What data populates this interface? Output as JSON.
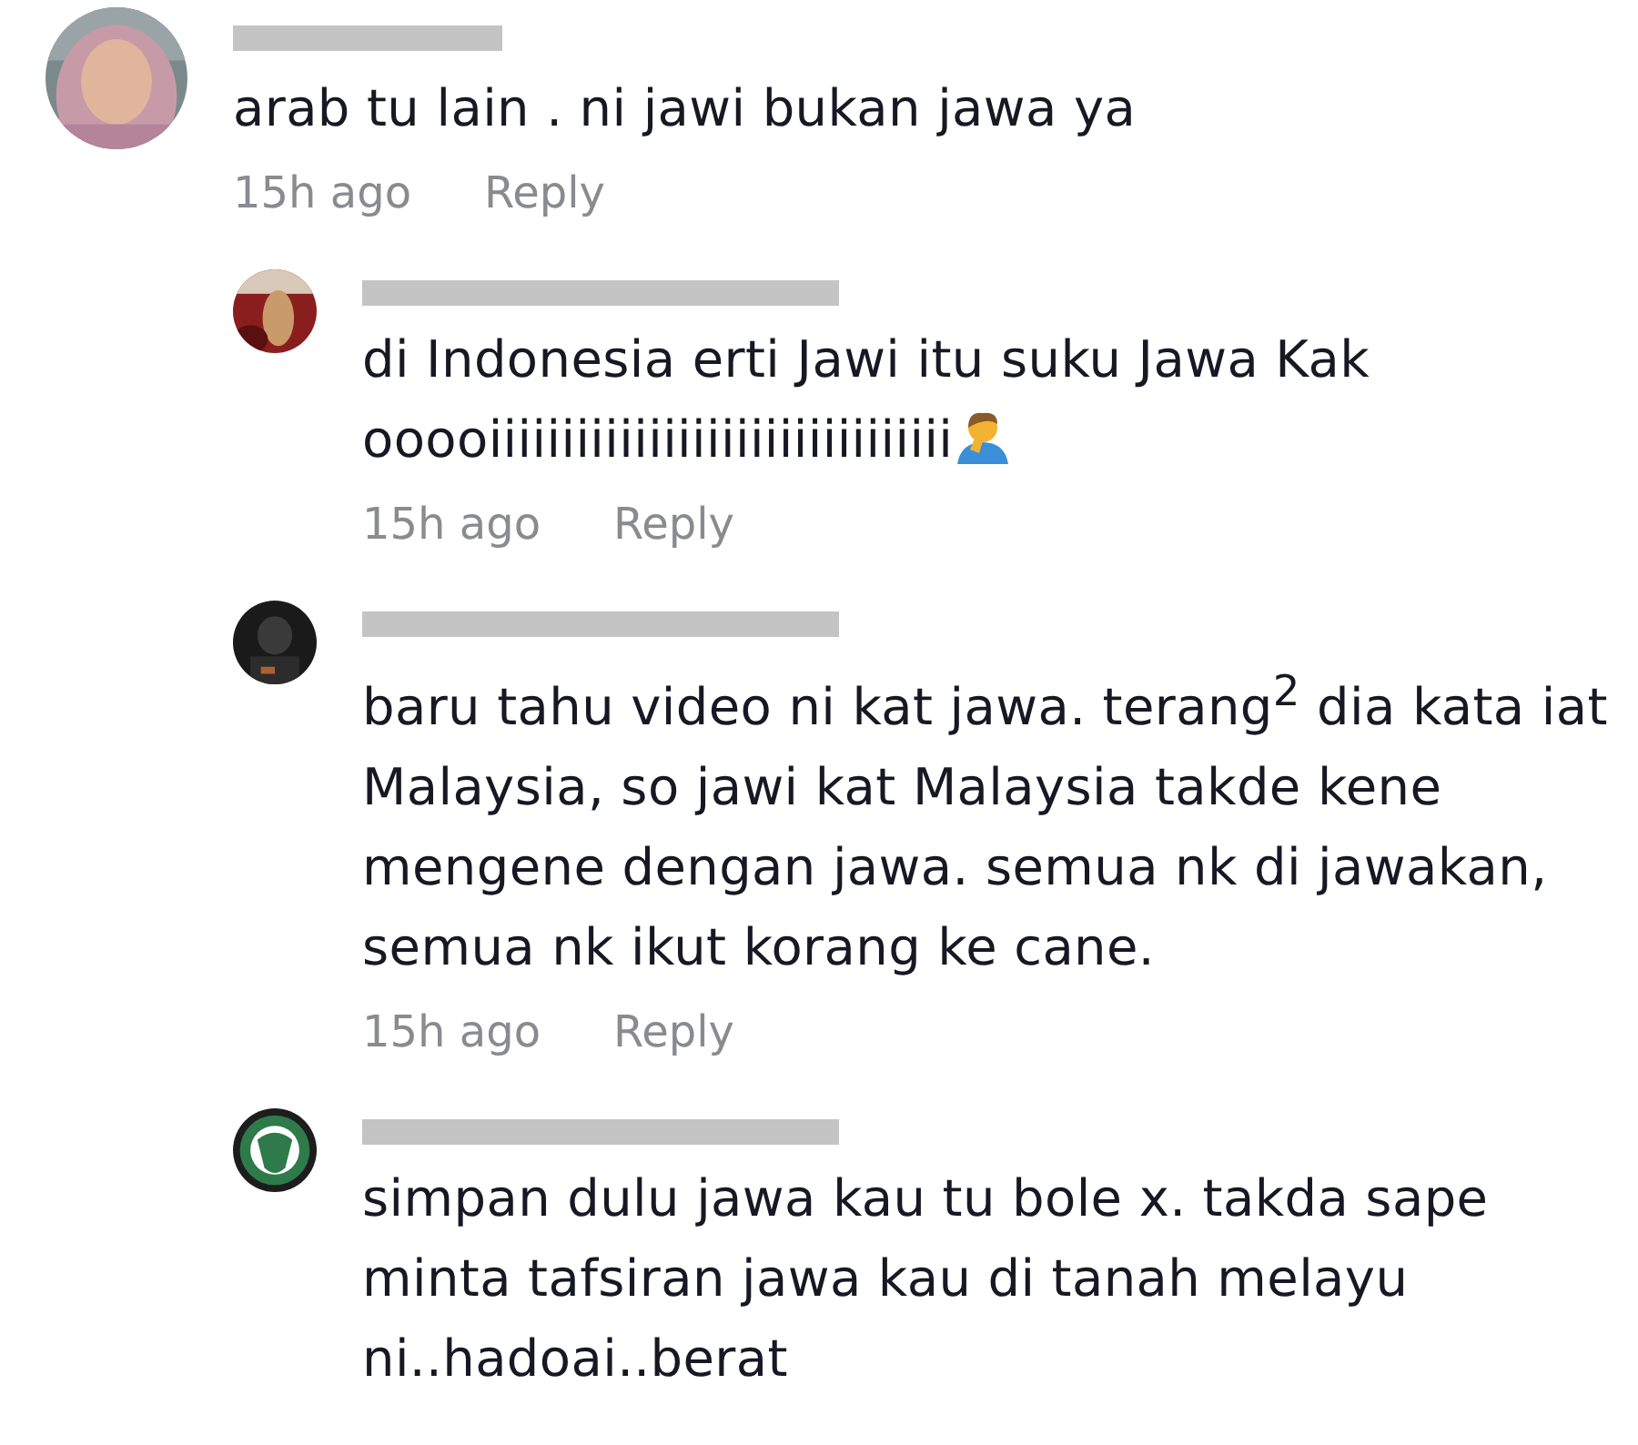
{
  "comments": [
    {
      "name_redacted": true,
      "text": "arab tu lain . ni jawi bukan jawa ya",
      "time": "15h ago",
      "reply_label": "Reply",
      "replies": [
        {
          "name_redacted": true,
          "text": "di Indonesia erti Jawi itu suku Jawa Kak\nooooiiiiiiiiiiiiiiiiiiiiiiiiiiiiiiii",
          "has_emoji": true,
          "time": "15h ago",
          "reply_label": "Reply"
        },
        {
          "name_redacted": true,
          "text": "baru tahu video ni kat jawa. terang$^{2}$ dia kata iat Malaysia, so jawi kat Malaysia takde kene mengene dengan jawa. semua nk di jawakan, semua nk ikut korang ke cane.",
          "time": "15h ago",
          "reply_label": "Reply"
        },
        {
          "name_redacted": true,
          "text": "simpan dulu jawa kau tu bole x. takda sape minta tafsiran jawa kau di tanah melayu ni..hadoai..berat"
        }
      ]
    }
  ]
}
